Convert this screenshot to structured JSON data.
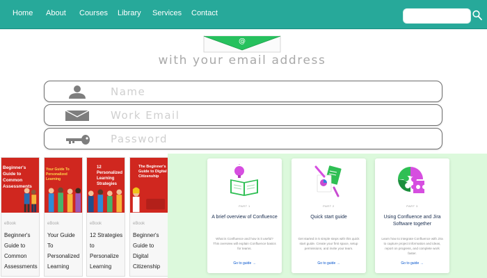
{
  "nav": {
    "items": [
      {
        "label": "Home"
      },
      {
        "label": "About"
      },
      {
        "label": "Courses"
      },
      {
        "label": "Library"
      },
      {
        "label": "Services"
      },
      {
        "label": "Contact"
      }
    ],
    "search_value": "",
    "icon": "search-icon"
  },
  "signup": {
    "tagline": "with your email address",
    "fields": [
      {
        "placeholder": "Name",
        "icon": "user-icon"
      },
      {
        "placeholder": "Work Email",
        "icon": "envelope-icon"
      },
      {
        "placeholder": "Password",
        "icon": "key-icon"
      }
    ]
  },
  "books": [
    {
      "cover_title": "Beginner's Guide to Common Assessments",
      "category": "eBook",
      "title": "Beginner's Guide to Common Assessments"
    },
    {
      "cover_title": "Your Guide To Personalized Learning",
      "category": "eBook",
      "title": "Your Guide To Personalized Learning"
    },
    {
      "cover_title": "12 Personalized Learning Strategies",
      "category": "eBook",
      "title": "12 Strategies to Personalize Learning"
    },
    {
      "cover_title": "The Beginner's Guide to Digital Citizenship",
      "category": "eBook",
      "title": "Beginner's Guide to Digital Citizenship"
    }
  ],
  "guides": [
    {
      "part": "PART 1",
      "title": "A brief overview of Confluence",
      "description": "What is Confluence and how is it useful? This overview will explain Confluence basics for teams.",
      "link": "Go to guide →",
      "icon": "book-idea-icon"
    },
    {
      "part": "PART 2",
      "title": "Quick start guide",
      "description": "Get started in 5 simple steps with this quick start guide. Create your first space, setup permissions, and invite your team.",
      "link": "Go to guide →",
      "icon": "pencil-document-icon"
    },
    {
      "part": "PART 3",
      "title": "Using Confluence and Jira Software together",
      "description": "Learn how to integrate Confluence with Jira to capture project information and ideas, report on progress, and complete work faster.",
      "link": "Go to guide →",
      "icon": "puzzle-icon"
    }
  ],
  "colors": {
    "nav_bg": "#27a99a",
    "book_cover": "#d0271f",
    "guides_bg": "#dcf9dc",
    "envelope_green": "#27c15e",
    "link_blue": "#0052cc"
  }
}
